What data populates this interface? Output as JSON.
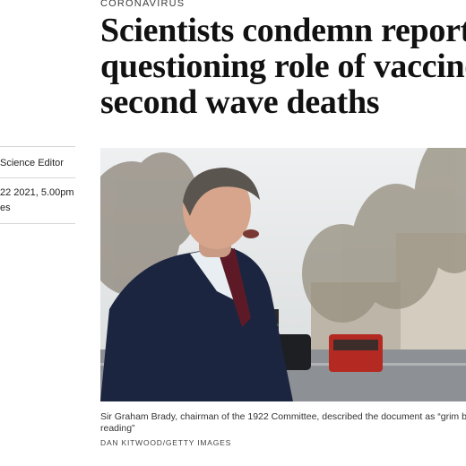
{
  "article": {
    "section": "CORONAVIRUS",
    "headline_lines": [
      "Scientists condemn report",
      "questioning role of vaccine",
      "second wave deaths"
    ],
    "byline_role": "Science Editor",
    "date_line1": "22 2021, 5.00pm",
    "date_line2": "es"
  },
  "image": {
    "caption_line1": "Sir Graham Brady, chairman of the 1922 Committee, described the document as “grim b",
    "caption_line2": "reading”",
    "credit": "DAN KITWOOD/GETTY IMAGES"
  }
}
